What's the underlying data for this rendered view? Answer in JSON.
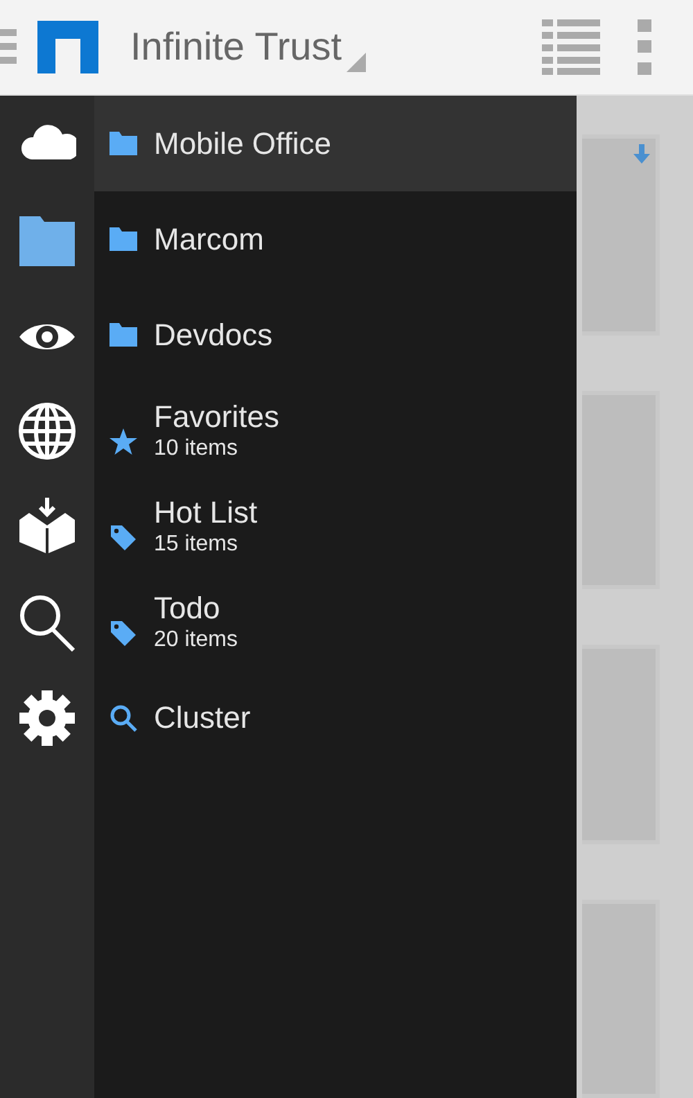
{
  "header": {
    "title": "Infinite Trust"
  },
  "rail": [
    {
      "kind": "cloud",
      "selected": false
    },
    {
      "kind": "folder",
      "selected": true
    },
    {
      "kind": "eye",
      "selected": false
    },
    {
      "kind": "globe",
      "selected": false
    },
    {
      "kind": "inbox",
      "selected": false
    },
    {
      "kind": "search",
      "selected": false
    },
    {
      "kind": "gear",
      "selected": false
    }
  ],
  "items": [
    {
      "kind": "folder",
      "label": "Mobile Office",
      "selected": true
    },
    {
      "kind": "folder",
      "label": "Marcom",
      "selected": false
    },
    {
      "kind": "folder",
      "label": "Devdocs",
      "selected": false
    },
    {
      "kind": "star",
      "label": "Favorites",
      "count": "10 items",
      "selected": false
    },
    {
      "kind": "tag",
      "label": "Hot List",
      "count": "15 items",
      "selected": false
    },
    {
      "kind": "tag",
      "label": "Todo",
      "count": "20 items",
      "selected": false
    },
    {
      "kind": "search",
      "label": "Cluster",
      "selected": false
    }
  ]
}
